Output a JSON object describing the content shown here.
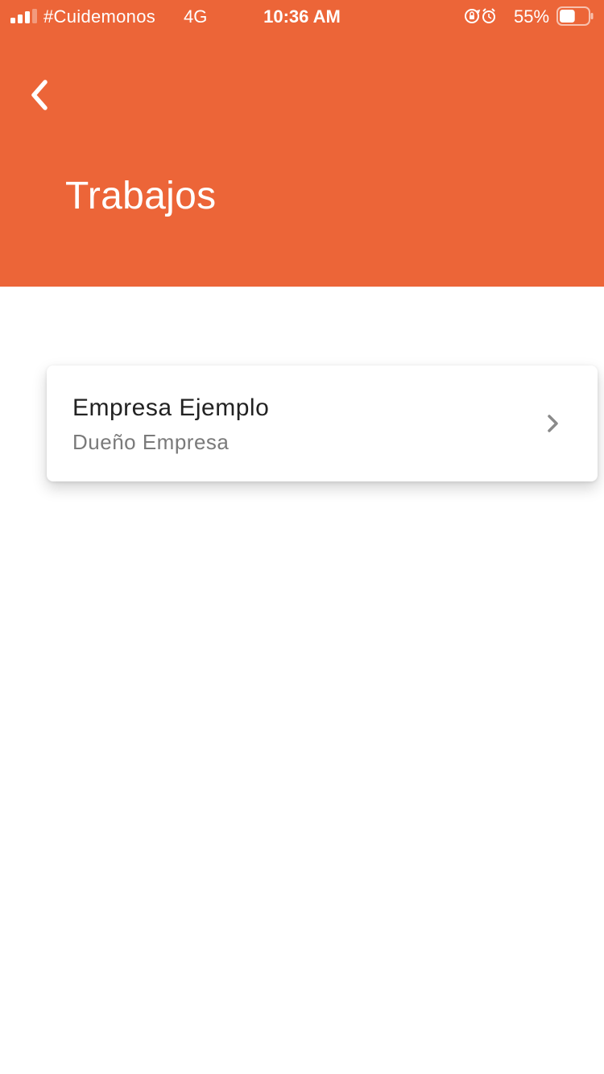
{
  "status_bar": {
    "carrier": "#Cuidemonos",
    "network": "4G",
    "time": "10:36 AM",
    "battery_percent": "55%",
    "battery_level": 0.55,
    "signal_bars_active": 3,
    "icons": [
      "signal-icon",
      "orientation-lock-icon",
      "alarm-icon",
      "battery-icon"
    ]
  },
  "header": {
    "background_color": "#EC6538",
    "back_icon": "chevron-left-icon",
    "title": "Trabajos"
  },
  "jobs": [
    {
      "title": "Empresa Ejemplo",
      "subtitle": "Dueño Empresa",
      "icon": "chevron-right-icon"
    }
  ]
}
